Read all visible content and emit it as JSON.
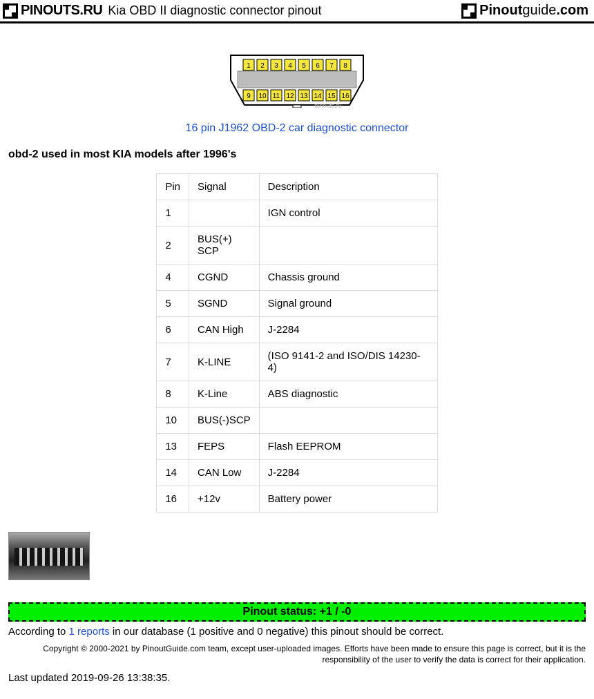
{
  "header": {
    "logo_ru": "PINOUTS.RU",
    "title": "Kia OBD II diagnostic connector pinout",
    "logo_guide_strong": "Pinout",
    "logo_guide_light": "guide",
    "logo_guide_tld": ".com"
  },
  "connector": {
    "pins_top": [
      "1",
      "2",
      "3",
      "4",
      "5",
      "6",
      "7",
      "8"
    ],
    "pins_bottom": [
      "9",
      "10",
      "11",
      "12",
      "13",
      "14",
      "15",
      "16"
    ],
    "watermark": "pinouts.ru",
    "link_text": "16 pin J1962 OBD-2 car diagnostic connector"
  },
  "intro": "obd-2 used in most KIA models after 1996's",
  "table": {
    "headers": [
      "Pin",
      "Signal",
      "Description"
    ],
    "rows": [
      {
        "pin": "1",
        "signal": "",
        "desc": "IGN control"
      },
      {
        "pin": "2",
        "signal": "BUS(+) SCP",
        "desc": ""
      },
      {
        "pin": "4",
        "signal": "CGND",
        "desc": "Chassis ground"
      },
      {
        "pin": "5",
        "signal": "SGND",
        "desc": "Signal ground"
      },
      {
        "pin": "6",
        "signal": "CAN High",
        "desc": "J-2284"
      },
      {
        "pin": "7",
        "signal": "K-LINE",
        "desc": "(ISO 9141-2 and ISO/DIS 14230-4)"
      },
      {
        "pin": "8",
        "signal": "K-Line",
        "desc": "ABS diagnostic"
      },
      {
        "pin": "10",
        "signal": "BUS(-)SCP",
        "desc": ""
      },
      {
        "pin": "13",
        "signal": "FEPS",
        "desc": "Flash EEPROM"
      },
      {
        "pin": "14",
        "signal": "CAN Low",
        "desc": "J-2284"
      },
      {
        "pin": "16",
        "signal": "+12v",
        "desc": "Battery power"
      }
    ]
  },
  "status": {
    "bar": "Pinout status: +1 / -0",
    "prefix": "According to ",
    "link": "1 reports",
    "suffix": " in our database (1 positive and 0 negative) this pinout should be correct."
  },
  "copyright": "Copyright © 2000-2021 by PinoutGuide.com team, except user-uploaded images. Efforts have been made to ensure this page is correct, but it is the responsibility of the user to verify the data is correct for their application.",
  "updated": "Last updated 2019-09-26 13:38:35."
}
